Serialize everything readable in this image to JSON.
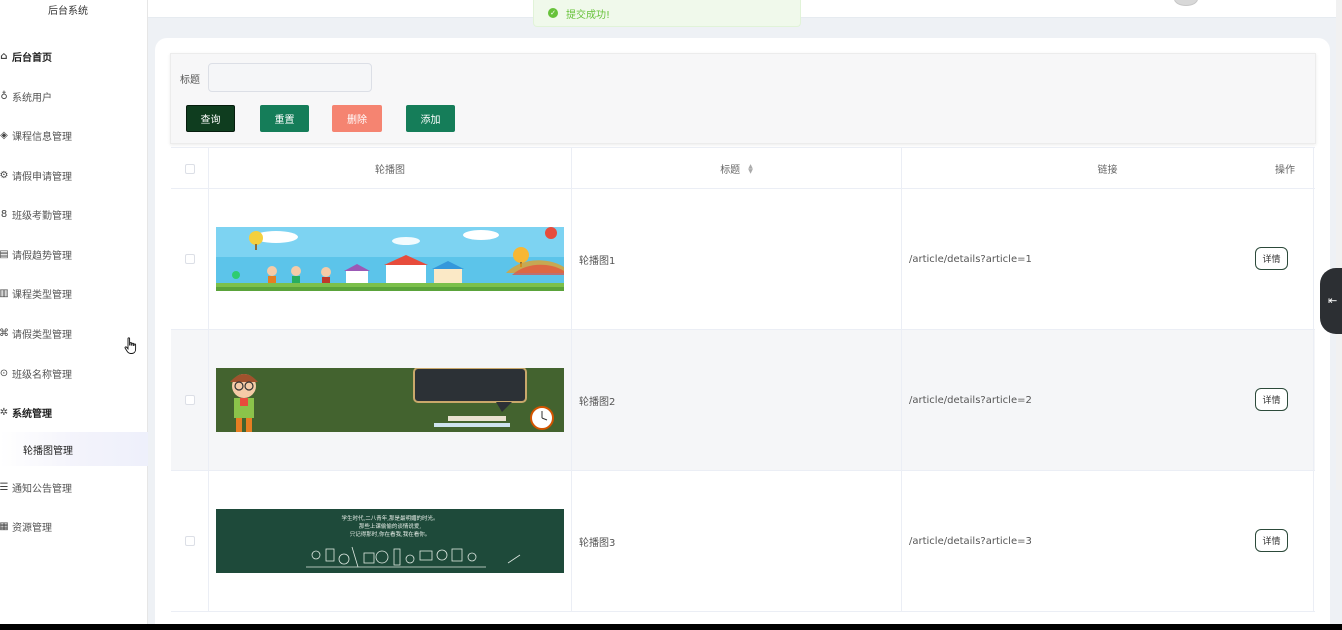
{
  "sidebar": {
    "brand": "后台系统",
    "items": [
      {
        "label": "后台首页",
        "icon": "home-icon"
      },
      {
        "label": "系统用户",
        "icon": "user-icon"
      },
      {
        "label": "课程信息管理",
        "icon": "cube-icon"
      },
      {
        "label": "请假申请管理",
        "icon": "gear-icon"
      },
      {
        "label": "班级考勤管理",
        "icon": "link-icon"
      },
      {
        "label": "请假趋势管理",
        "icon": "document-icon"
      },
      {
        "label": "课程类型管理",
        "icon": "notebook-icon"
      },
      {
        "label": "请假类型管理",
        "icon": "share-icon"
      },
      {
        "label": "班级名称管理",
        "icon": "comment-icon"
      },
      {
        "label": "系统管理",
        "icon": "tools-icon"
      },
      {
        "label": "通知公告管理",
        "icon": "list-icon"
      },
      {
        "label": "资源管理",
        "icon": "resource-icon"
      }
    ],
    "submenu_active": "轮播图管理"
  },
  "toast": {
    "message": "提交成功!"
  },
  "search": {
    "title_label": "标题",
    "title_value": "",
    "query_label": "查询",
    "reset_label": "重置",
    "delete_label": "删除",
    "add_label": "添加"
  },
  "table": {
    "headers": {
      "image": "轮播图",
      "title": "标题",
      "link": "链接",
      "action": "操作"
    },
    "rows": [
      {
        "title": "轮播图1",
        "link": "/article/details?article=1",
        "action": "详情"
      },
      {
        "title": "轮播图2",
        "link": "/article/details?article=2",
        "action": "详情"
      },
      {
        "title": "轮播图3",
        "link": "/article/details?article=3",
        "action": "详情"
      }
    ]
  },
  "banner3_text": {
    "line1": "学生时代,二八青年,那是最明媚的时光。",
    "line2": "那些上课偷偷的谈情说爱,",
    "line3": "只记得那时,你在看我,我在看你。"
  }
}
